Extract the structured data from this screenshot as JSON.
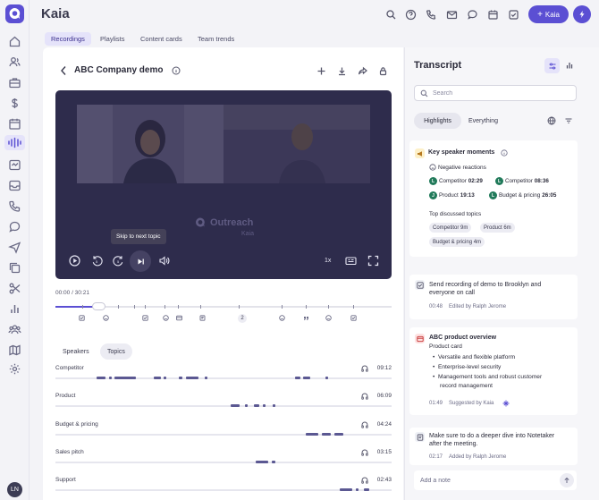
{
  "app": {
    "title": "Kaia"
  },
  "header": {
    "kaia_button": "Kaia"
  },
  "tabs": [
    {
      "label": "Recordings",
      "active": true
    },
    {
      "label": "Playlists"
    },
    {
      "label": "Content cards"
    },
    {
      "label": "Team trends"
    }
  ],
  "recording": {
    "title": "ABC Company demo"
  },
  "video": {
    "brand": "Outreach",
    "brand_sub": "Kaia",
    "tooltip": "Skip to next topic",
    "speed": "1x",
    "timecode": "00:00  /  30:21",
    "progress": 0.13
  },
  "timeline": {
    "event_badge": "2"
  },
  "segments": {
    "speakers": "Speakers",
    "topics": "Topics"
  },
  "topics": [
    {
      "name": "Competitor",
      "time": "09:12"
    },
    {
      "name": "Product",
      "time": "06:09"
    },
    {
      "name": "Budget & pricing",
      "time": "04:24"
    },
    {
      "name": "Sales pitch",
      "time": "03:15"
    },
    {
      "name": "Support",
      "time": "02:43"
    }
  ],
  "transcript": {
    "title": "Transcript",
    "search_placeholder": "Search",
    "highlights": "Highlights",
    "everything": "Everything"
  },
  "key_moments": {
    "title": "Key speaker moments",
    "negative_label": "Negative reactions",
    "reactions": [
      {
        "badge": "L",
        "label": "Competitor",
        "time": "02:29"
      },
      {
        "badge": "L",
        "label": "Competitor",
        "time": "08:36"
      },
      {
        "badge": "J",
        "label": "Product",
        "time": "19:13"
      },
      {
        "badge": "L",
        "label": "Budget & pricing",
        "time": "26:05"
      }
    ],
    "topics_label": "Top discussed topics",
    "topic_pills": [
      "Competitor 9m",
      "Product 6m",
      "Budget & pricing 4m"
    ]
  },
  "task1": {
    "text_line1": "Send recording of demo to Brooklyn and",
    "text_line2": "everyone on call",
    "time": "00:48",
    "meta": "Edited by Ralph Jerome"
  },
  "product_overview": {
    "title": "ABC product overview",
    "subtitle": "Product card",
    "bullets": [
      "Versatile and flexible platform",
      "Enterprise-level security",
      "Management tools and robust customer",
      "record management"
    ],
    "time": "01:49",
    "meta": "Suggested by Kaia"
  },
  "task2": {
    "text_line1": "Make sure to do a deeper dive into Notetaker",
    "text_line2": "after the meeting.",
    "time": "02:17",
    "meta": "Added by Ralph Jerome"
  },
  "note": {
    "placeholder": "Add a note"
  },
  "user": {
    "initials": "LN"
  },
  "colors": {
    "accent": "#5b4fd3",
    "video_bg": "#2e2c4c",
    "topic_bar": "#5b5892",
    "speaker_badge": "#217a5a"
  }
}
